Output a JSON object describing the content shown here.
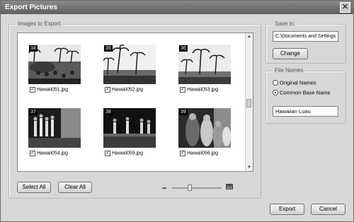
{
  "window": {
    "title": "Export Pictures"
  },
  "images_group": {
    "legend": "Images to Export",
    "tiles": [
      {
        "number": "34",
        "filename": "Hawaii051.jpg",
        "checked": true
      },
      {
        "number": "35",
        "filename": "Hawaii052.jpg",
        "checked": true
      },
      {
        "number": "36",
        "filename": "Hawaii053.jpg",
        "checked": true
      },
      {
        "number": "37",
        "filename": "Hawaii054.jpg",
        "checked": true
      },
      {
        "number": "38",
        "filename": "Hawaii055.jpg",
        "checked": true
      },
      {
        "number": "39",
        "filename": "Hawaii056.jpg",
        "checked": true
      }
    ],
    "select_all_label": "Select All",
    "clear_all_label": "Clear All",
    "zoom_level": 0.35
  },
  "save_in": {
    "legend": "Save in:",
    "path": "C:\\Documents and Settings",
    "change_label": "Change"
  },
  "file_names": {
    "legend": "File Names",
    "option_original": "Original Names",
    "option_common": "Common Base Name",
    "selected": "common",
    "base_name": "Hawaiian Luau"
  },
  "footer": {
    "export_label": "Export",
    "cancel_label": "Cancel"
  }
}
